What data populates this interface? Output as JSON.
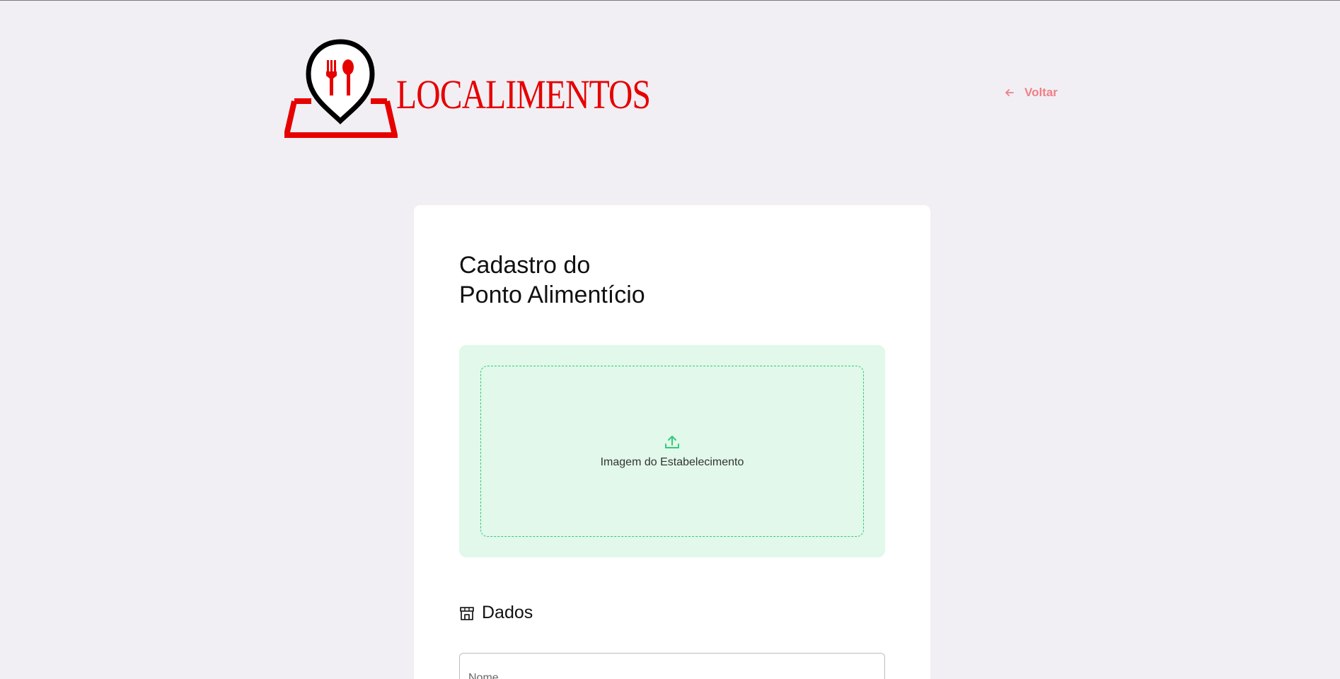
{
  "header": {
    "logo_text": "LOCALIMENTOS",
    "logo_icon": "map-pin-fork-spoon-icon",
    "back_label": "Voltar",
    "back_icon": "arrow-left-icon"
  },
  "form": {
    "title_line1": "Cadastro do",
    "title_line2": "Ponto Alimentício",
    "upload_label": "Imagem do Estabelecimento",
    "upload_icon": "upload-icon",
    "section_title": "Dados",
    "section_icon": "store-icon",
    "name_placeholder": "Nome"
  },
  "colors": {
    "brand_red": "#e60000",
    "back_link": "#ef7f86",
    "accent_green": "#34cb79",
    "dropzone_bg": "#e1f8ea",
    "page_bg": "#f1eff4"
  }
}
